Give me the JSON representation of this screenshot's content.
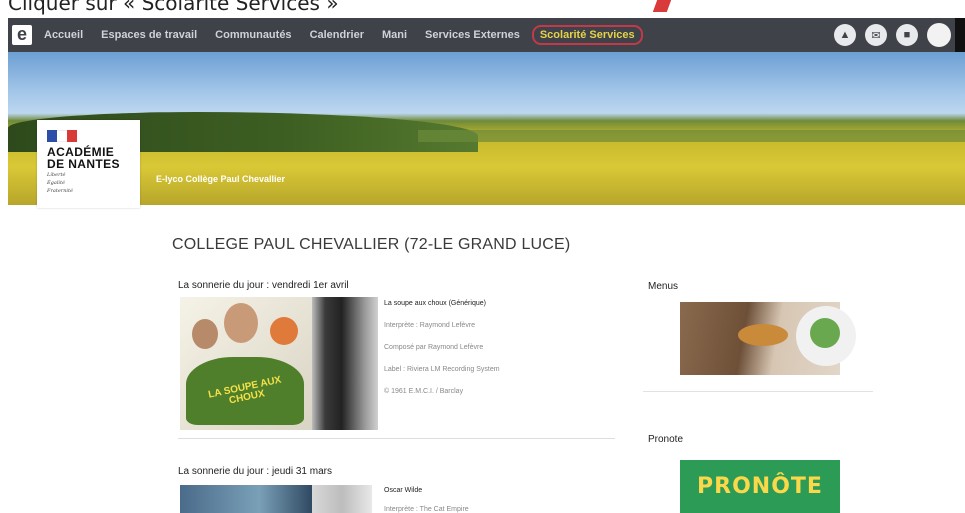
{
  "caption": {
    "text": "Cliquer sur « Scolarité Services »"
  },
  "nav": {
    "logo": "e",
    "items": [
      {
        "label": "Accueil"
      },
      {
        "label": "Espaces de travail"
      },
      {
        "label": "Communautés"
      },
      {
        "label": "Calendrier"
      },
      {
        "label": "Mani"
      },
      {
        "label": "Services Externes"
      },
      {
        "label": "Scolarité Services"
      }
    ],
    "highlight_color": "#c23a4a",
    "icons": [
      "bell-icon",
      "mail-icon",
      "chat-icon",
      "avatar"
    ]
  },
  "banner": {
    "title": "E-lyco Collège Paul Chevallier"
  },
  "academy": {
    "line1": "ACADÉMIE",
    "line2": "DE NANTES",
    "motto1": "Liberté",
    "motto2": "Égalité",
    "motto3": "Fraternité"
  },
  "main": {
    "college_title": "COLLEGE PAUL CHEVALLIER (72-LE GRAND LUCE)",
    "post1": {
      "title": "La sonnerie du jour : vendredi 1er avril",
      "song": "La soupe aux choux (Générique)",
      "lines": [
        "Interprète : Raymond Lefèvre",
        "Composé par Raymond Lefèvre",
        "Label : Riviera LM Recording System",
        "© 1961 E.M.C.I. / Barclay"
      ],
      "cover_text": "LA SOUPE AUX CHOUX"
    },
    "post2": {
      "title": "La sonnerie du jour : jeudi 31 mars",
      "song": "Oscar Wilde",
      "line1": "Interprète : The Cat Empire"
    }
  },
  "sidebar": {
    "menus_title": "Menus",
    "pronote_title": "Pronote",
    "pronote_logo": "PRONÔTE"
  }
}
